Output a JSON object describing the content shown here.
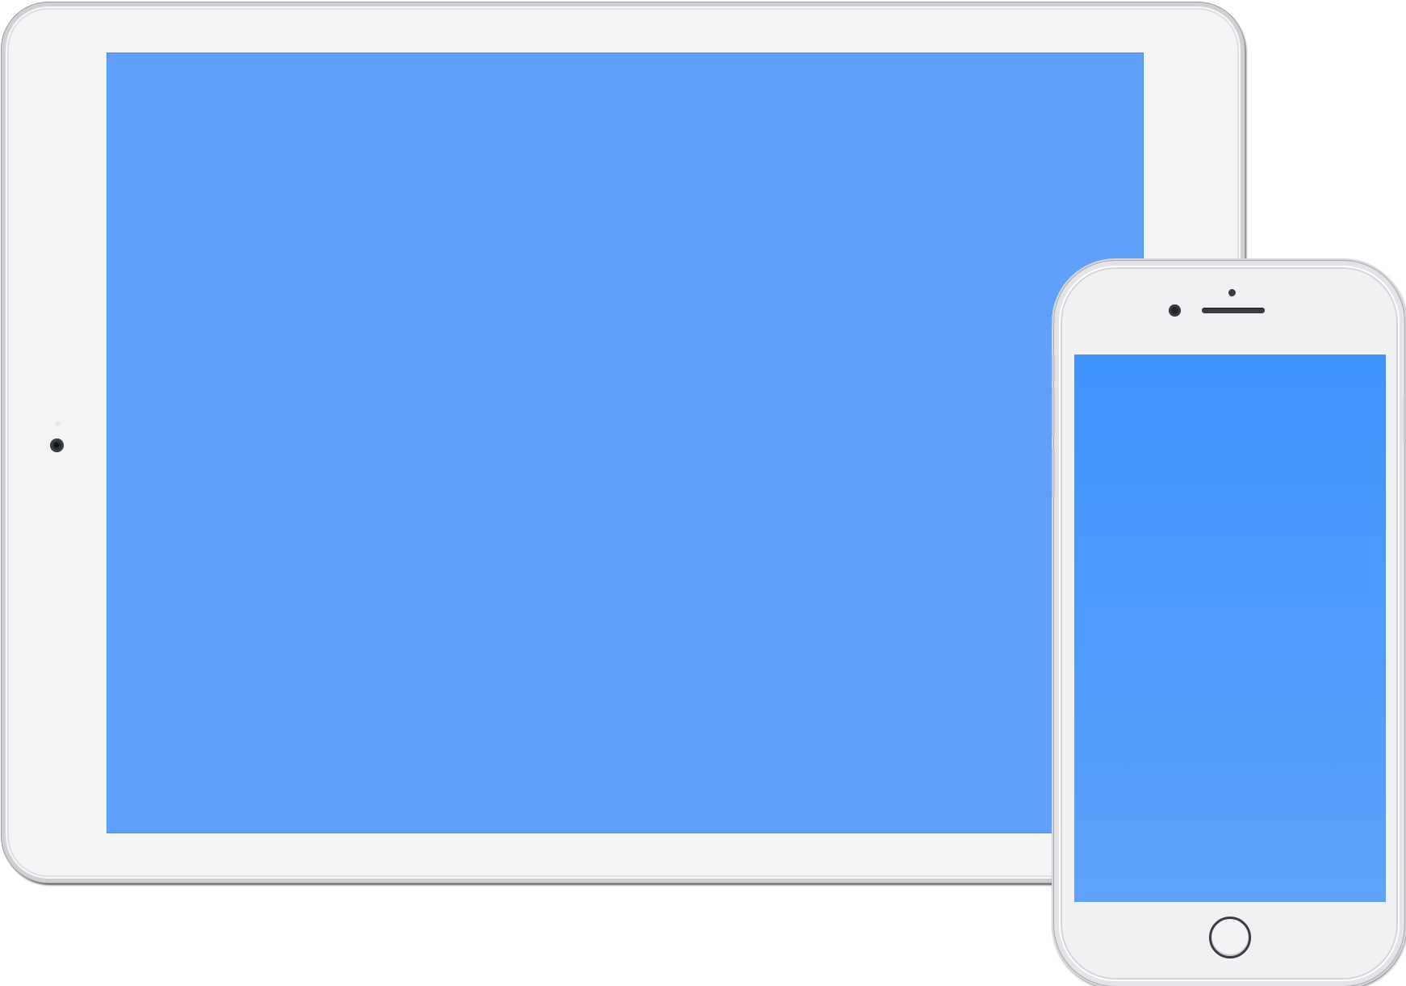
{
  "devices": {
    "tablet": {
      "frame_color": "#f3f4f6",
      "screen_color": "#60a0fd",
      "camera": "front-camera-icon",
      "sensor": "ambient-sensor-icon"
    },
    "phone": {
      "frame_color": "#f0f1f3",
      "screen_color_top": "#3f94fd",
      "screen_color_bottom": "#5ea2fd",
      "camera": "front-camera-icon",
      "speaker": "earpiece-speaker-icon",
      "home_button": "home-button-icon"
    }
  }
}
